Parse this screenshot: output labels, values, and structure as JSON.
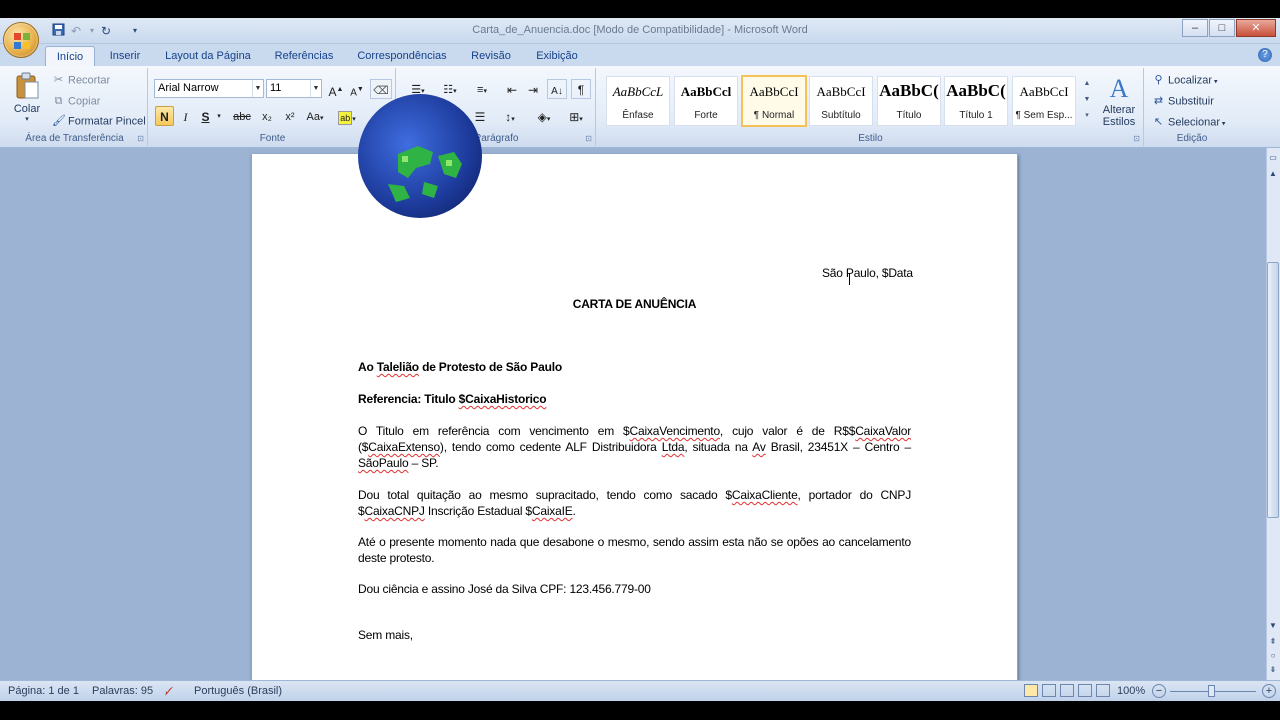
{
  "window": {
    "title": "Carta_de_Anuencia.doc [Modo de Compatibilidade] - Microsoft Word",
    "controls": {
      "minimize": "–",
      "maximize": "□",
      "close": "✕"
    }
  },
  "tabs": [
    "Início",
    "Inserir",
    "Layout da Página",
    "Referências",
    "Correspondências",
    "Revisão",
    "Exibição"
  ],
  "active_tab": "Início",
  "clipboard": {
    "paste": "Colar",
    "cut": "Recortar",
    "copy": "Copiar",
    "format_painter": "Formatar Pincel",
    "label": "Área de Transferência"
  },
  "font": {
    "name": "Arial Narrow",
    "size": "11",
    "bold": "N",
    "italic": "I",
    "underline": "S",
    "strike": "abc",
    "subscript": "x₂",
    "superscript": "x²",
    "change_case": "Aa",
    "grow": "A",
    "shrink": "A",
    "label": "Fonte"
  },
  "paragraph": {
    "label": "Parágrafo"
  },
  "styles": {
    "label": "Estilo",
    "items": [
      {
        "sample": "AaBbCcL",
        "name": "Ênfase"
      },
      {
        "sample": "AaBbCcl",
        "name": "Forte"
      },
      {
        "sample": "AaBbCcI",
        "name": "¶ Normal"
      },
      {
        "sample": "AaBbCcI",
        "name": "Subtítulo"
      },
      {
        "sample": "AaBbC(",
        "name": "Título"
      },
      {
        "sample": "AaBbC(",
        "name": "Título 1"
      },
      {
        "sample": "AaBbCcI",
        "name": "¶ Sem Esp..."
      }
    ],
    "change_styles_line1": "Alterar",
    "change_styles_line2": "Estilos"
  },
  "editing": {
    "find": "Localizar",
    "replace": "Substituir",
    "select": "Selecionar",
    "label": "Edição"
  },
  "document": {
    "date_line": "São Paulo, $Data",
    "heading": "CARTA DE ANUÊNCIA",
    "addressee_prefix": "Ao ",
    "addressee_word": "Talelião",
    "addressee_rest": " de Protesto de São Paulo",
    "reference_prefix": "Referencia: Titulo ",
    "reference_var": "$CaixaHistorico",
    "p1_a": "O Titulo em referência com vencimento em $",
    "p1_var1": "CaixaVencimento",
    "p1_b": ", cujo valor é de R$$",
    "p1_var2": "CaixaValor",
    "p1_c": " ($",
    "p1_var3": "CaixaExtenso",
    "p1_d": "), tendo como cedente ALF Distribuidora ",
    "p1_var4": "Ltda",
    "p1_e": ", situada na ",
    "p1_var5": "Av",
    "p1_f": " Brasil, 23451X – Centro – ",
    "p1_var6": "SãoPaulo",
    "p1_g": " – SP.",
    "p2_a": "Dou total quitação ao mesmo supracitado, tendo como sacado $",
    "p2_var1": "CaixaCliente",
    "p2_b": ", portador do CNPJ $",
    "p2_var2": "CaixaCNPJ",
    "p2_c": " Inscrição Estadual $",
    "p2_var3": "CaixaIE",
    "p2_d": ".",
    "p3": "Até o presente momento nada que desabone o mesmo, sendo assim esta não se opões ao cancelamento deste protesto.",
    "p4": "Dou ciência e assino José da Silva CPF: 123.456.779-00",
    "closing": "Sem mais,"
  },
  "status": {
    "page": "Página: 1 de 1",
    "words": "Palavras: 95",
    "language": "Português (Brasil)",
    "zoom": "100%"
  },
  "colors": {
    "ribbon_blue": "#c9d9ee",
    "tab_text": "#15428b",
    "doc_background": "#9cb3d3",
    "highlight_button": "#f6c85a"
  }
}
